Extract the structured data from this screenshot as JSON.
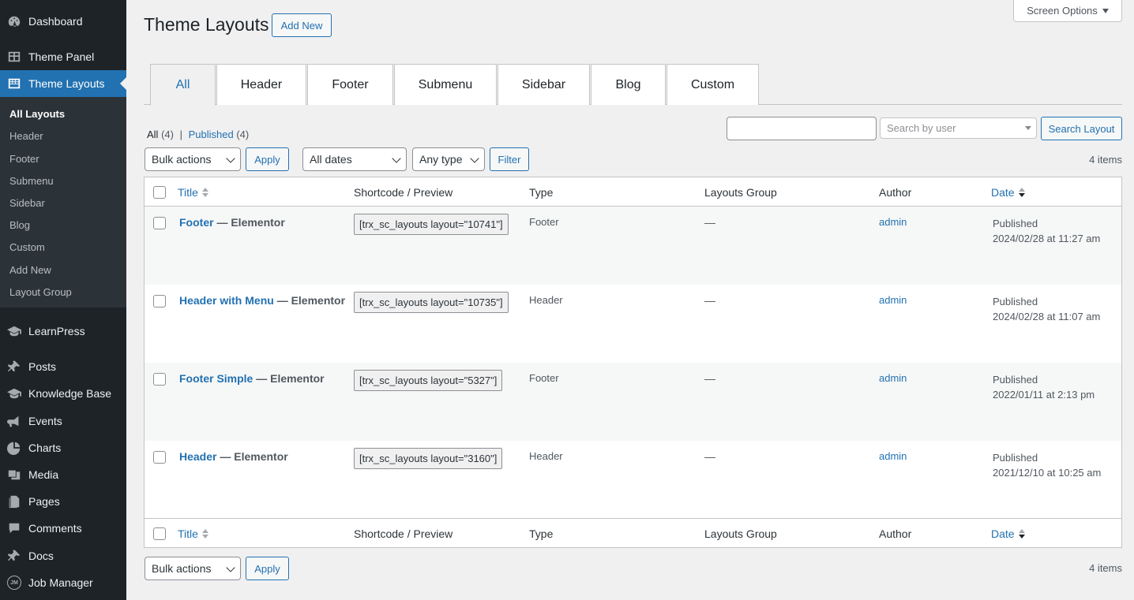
{
  "sidebar": {
    "items": [
      {
        "label": "Dashboard",
        "icon": "dashboard-icon"
      },
      {
        "label": "Theme Panel",
        "icon": "theme-panel-icon"
      },
      {
        "label": "Theme Layouts",
        "icon": "layouts-icon"
      },
      {
        "label": "LearnPress",
        "icon": "graduation-cap-icon"
      },
      {
        "label": "Posts",
        "icon": "pushpin-icon"
      },
      {
        "label": "Knowledge Base",
        "icon": "graduation-cap-icon"
      },
      {
        "label": "Events",
        "icon": "megaphone-icon"
      },
      {
        "label": "Charts",
        "icon": "pie-chart-icon"
      },
      {
        "label": "Media",
        "icon": "media-icon"
      },
      {
        "label": "Pages",
        "icon": "pages-icon"
      },
      {
        "label": "Comments",
        "icon": "comment-icon"
      },
      {
        "label": "Docs",
        "icon": "pushpin-icon"
      },
      {
        "label": "Job Manager",
        "icon": "job-manager-icon",
        "icon_text": "JM"
      }
    ],
    "submenu": [
      "All Layouts",
      "Header",
      "Footer",
      "Submenu",
      "Sidebar",
      "Blog",
      "Custom",
      "Add New",
      "Layout Group"
    ]
  },
  "header": {
    "title": "Theme Layouts",
    "add_new": "Add New",
    "screen_options": "Screen Options"
  },
  "tabs": [
    "All",
    "Header",
    "Footer",
    "Submenu",
    "Sidebar",
    "Blog",
    "Custom"
  ],
  "filters": {
    "all_label": "All",
    "all_count": "(4)",
    "separator": "|",
    "published_label": "Published",
    "published_count": "(4)",
    "bulk_actions": "Bulk actions",
    "apply": "Apply",
    "all_dates": "All dates",
    "any_type": "Any type",
    "filter": "Filter",
    "search_value": "",
    "search_by_user_placeholder": "Search by user",
    "search_button": "Search Layout",
    "items_count": "4 items"
  },
  "table": {
    "columns": [
      "Title",
      "Shortcode / Preview",
      "Type",
      "Layouts Group",
      "Author",
      "Date"
    ],
    "rows": [
      {
        "title": "Footer",
        "suffix": "— Elementor",
        "shortcode": "[trx_sc_layouts layout=\"10741\"]",
        "type": "Footer",
        "group": "—",
        "author": "admin",
        "status": "Published",
        "date": "2024/02/28 at 11:27 am"
      },
      {
        "title": "Header with Menu",
        "suffix": "— Elementor",
        "shortcode": "[trx_sc_layouts layout=\"10735\"]",
        "type": "Header",
        "group": "—",
        "author": "admin",
        "status": "Published",
        "date": "2024/02/28 at 11:07 am"
      },
      {
        "title": "Footer Simple",
        "suffix": "— Elementor",
        "shortcode": "[trx_sc_layouts layout=\"5327\"]",
        "type": "Footer",
        "group": "—",
        "author": "admin",
        "status": "Published",
        "date": "2022/01/11 at 2:13 pm"
      },
      {
        "title": "Header",
        "suffix": "— Elementor",
        "shortcode": "[trx_sc_layouts layout=\"3160\"]",
        "type": "Header",
        "group": "—",
        "author": "admin",
        "status": "Published",
        "date": "2021/12/10 at 10:25 am"
      }
    ]
  },
  "colors": {
    "accent": "#2271b1",
    "sidebar_bg": "#1d2327",
    "submenu_bg": "#2c3338"
  }
}
